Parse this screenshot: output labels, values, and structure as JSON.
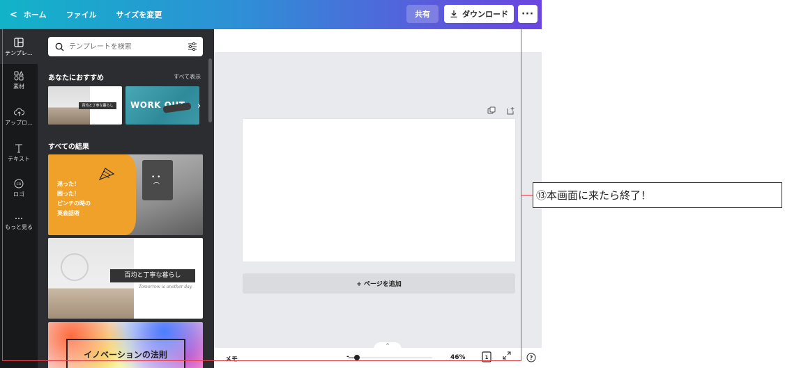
{
  "topbar": {
    "home": "ホーム",
    "file": "ファイル",
    "resize": "サイズを変更",
    "share": "共有",
    "download": "ダウンロード",
    "more": "···"
  },
  "rail": {
    "items": [
      {
        "label": "テンプレ…",
        "icon": "template-icon"
      },
      {
        "label": "素材",
        "icon": "elements-icon"
      },
      {
        "label": "アップロ…",
        "icon": "upload-icon"
      },
      {
        "label": "テキスト",
        "icon": "text-icon"
      },
      {
        "label": "ロゴ",
        "icon": "logo-icon"
      },
      {
        "label": "もっと見る",
        "icon": "more-icon"
      }
    ]
  },
  "panel": {
    "search_placeholder": "テンプレートを検索",
    "recommended_title": "あなたにおすすめ",
    "see_all": "すべて表示",
    "all_results_title": "すべての結果",
    "thumb1_label": "百均と丁寧な暮らし",
    "thumb2_text": "WORK OUT",
    "thumb3_lines": [
      "迷った！",
      "困った！",
      "ピンチの時の",
      "英会話術"
    ],
    "thumb4_label": "百均と丁寧な暮らし",
    "thumb4_signature": "Tomorrow is another day",
    "thumb5_title": "イノベーションの法則"
  },
  "canvas": {
    "add_page": "+ ページを追加"
  },
  "bottombar": {
    "memo": "メモ",
    "zoom": "46%",
    "zoom_level": 0.46,
    "page_count": "1"
  },
  "annotation": {
    "text": "⑬本画面に来たら終了！"
  },
  "colors": {
    "accent_red": "#e8404a",
    "panel_bg": "#2b2d30",
    "rail_bg": "#18191b"
  }
}
